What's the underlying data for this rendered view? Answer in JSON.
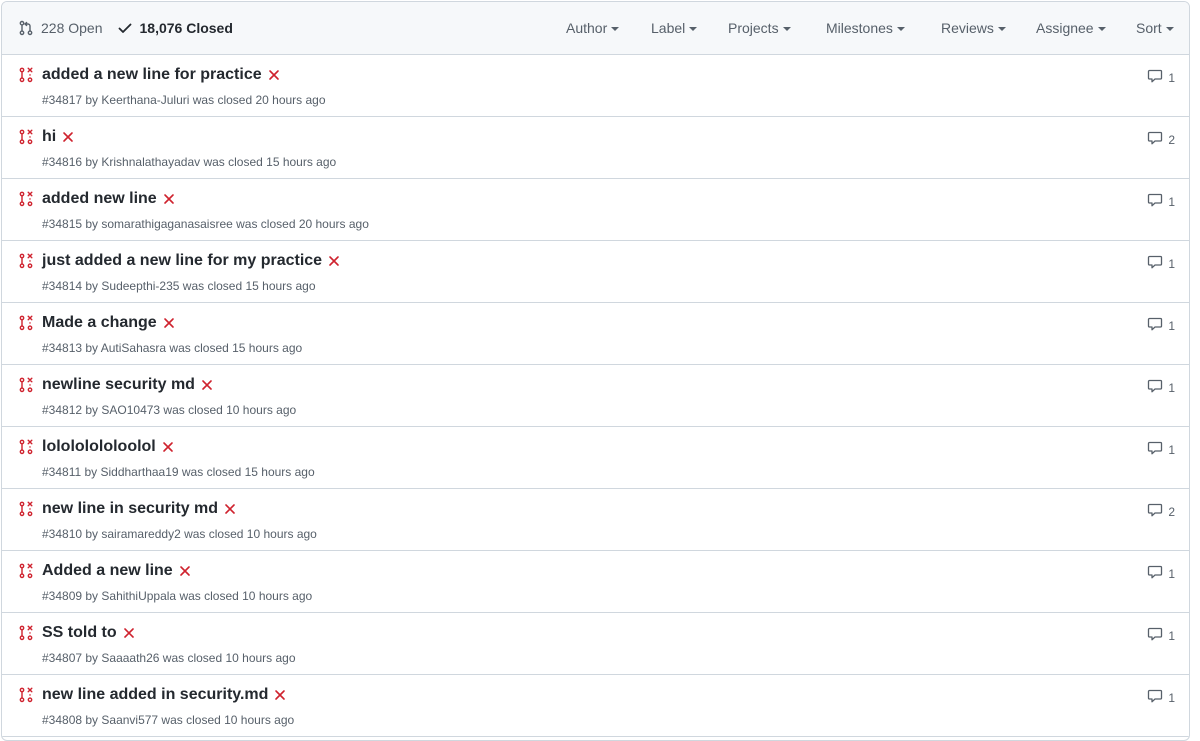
{
  "header": {
    "open_label": "228 Open",
    "closed_label": "18,076 Closed",
    "filters": [
      "Author",
      "Label",
      "Projects",
      "Milestones",
      "Reviews",
      "Assignee",
      "Sort"
    ]
  },
  "pulls": [
    {
      "title": "added a new line for practice",
      "meta": "#34817 by Keerthana-Juluri was closed 20 hours ago",
      "comments": "1"
    },
    {
      "title": "hi",
      "meta": "#34816 by Krishnalathayadav was closed 15 hours ago",
      "comments": "2"
    },
    {
      "title": "added new line",
      "meta": "#34815 by somarathigaganasaisree was closed 20 hours ago",
      "comments": "1"
    },
    {
      "title": "just added a new line for my practice",
      "meta": "#34814 by Sudeepthi-235 was closed 15 hours ago",
      "comments": "1"
    },
    {
      "title": "Made a change",
      "meta": "#34813 by AutiSahasra was closed 15 hours ago",
      "comments": "1"
    },
    {
      "title": "newline security md",
      "meta": "#34812 by SAO10473 was closed 10 hours ago",
      "comments": "1"
    },
    {
      "title": "lolololololoolol",
      "meta": "#34811 by Siddharthaa19 was closed 15 hours ago",
      "comments": "1"
    },
    {
      "title": "new line in security md",
      "meta": "#34810 by sairamareddy2 was closed 10 hours ago",
      "comments": "2"
    },
    {
      "title": "Added a new line",
      "meta": "#34809 by SahithiUppala was closed 10 hours ago",
      "comments": "1"
    },
    {
      "title": "SS told to",
      "meta": "#34807 by Saaaath26 was closed 10 hours ago",
      "comments": "1"
    },
    {
      "title": "new line added in security.md",
      "meta": "#34808 by Saanvi577 was closed 10 hours ago",
      "comments": "1"
    }
  ],
  "colors": {
    "closed_pr": "#cf222e",
    "x_mark": "#cf222e",
    "muted": "#57606a",
    "border": "#d0d7de",
    "header_bg": "#f6f8fa"
  },
  "icons": {
    "open": "git-pull-request-icon",
    "closed": "check-icon",
    "row": "git-pull-request-closed-icon",
    "status": "x-icon",
    "comments": "comment-icon"
  }
}
